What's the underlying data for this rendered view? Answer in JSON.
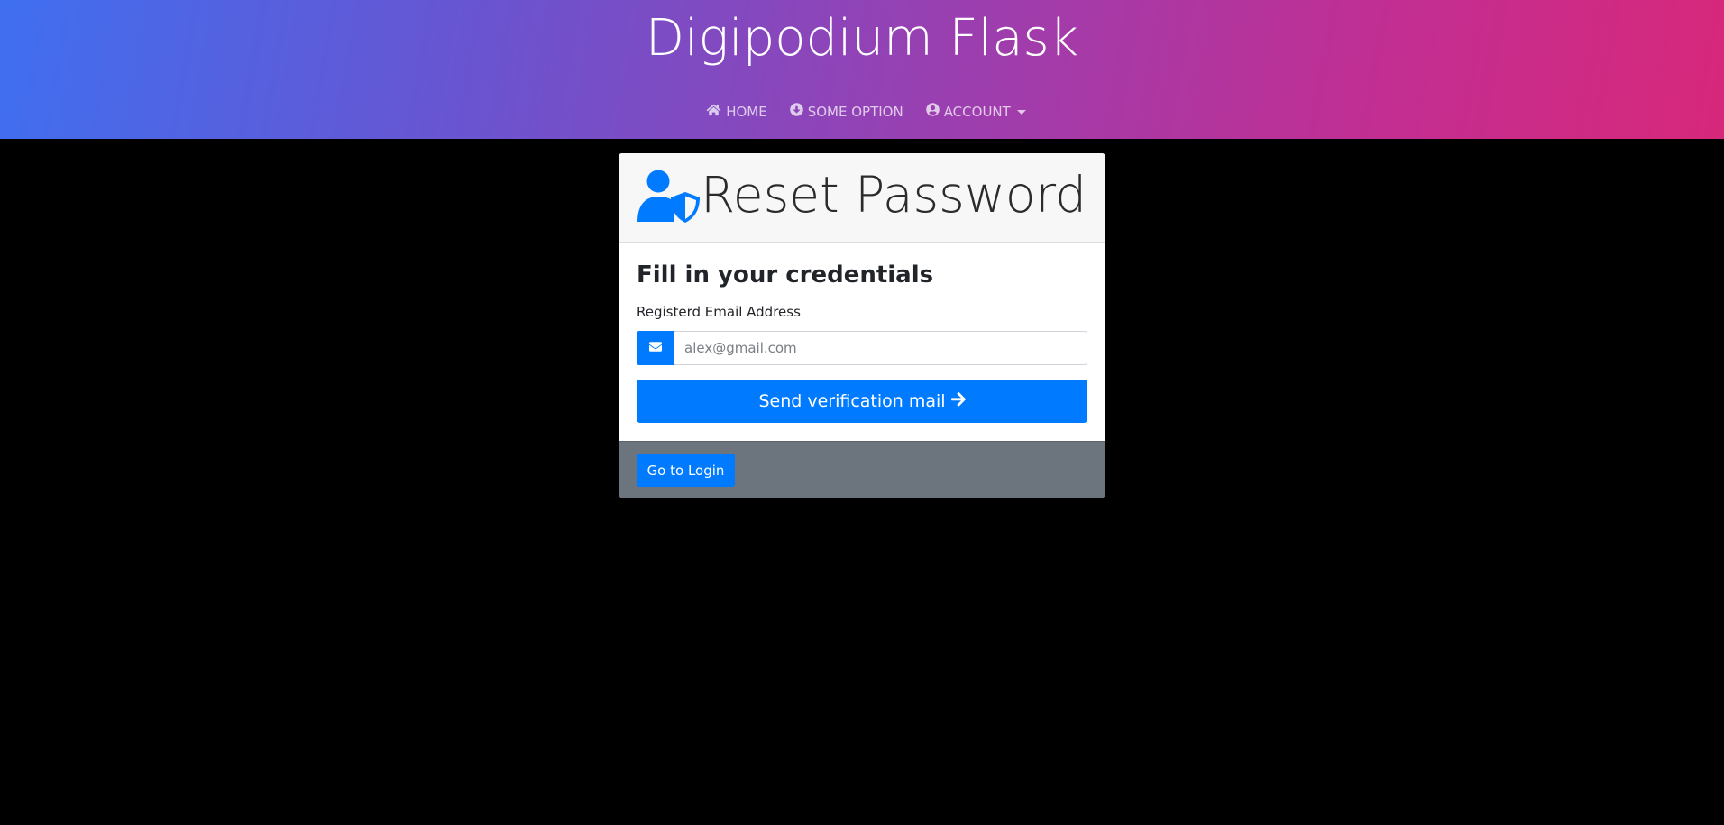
{
  "header": {
    "site_title": "Digipodium Flask",
    "nav": [
      {
        "label": "HOME",
        "icon": "home-icon"
      },
      {
        "label": "SOME OPTION",
        "icon": "download-circle-icon"
      },
      {
        "label": "ACCOUNT",
        "icon": "user-circle-icon",
        "has_dropdown": true
      }
    ]
  },
  "card": {
    "title": "Reset Password",
    "title_icon": "user-shield-icon",
    "form_heading": "Fill in your credentials",
    "email_label": "Registerd Email Address",
    "email_placeholder": "alex@gmail.com",
    "email_value": "",
    "email_icon": "envelope-icon",
    "send_button_label": "Send verification mail",
    "send_button_icon": "arrow-right-icon",
    "footer": {
      "login_button_label": "Go to Login"
    }
  },
  "colors": {
    "primary": "#007bff",
    "footer_bg": "#6c757d",
    "page_bg": "#000000",
    "header_gradient_start": "#3f6ff0",
    "header_gradient_end": "#d7287a"
  }
}
